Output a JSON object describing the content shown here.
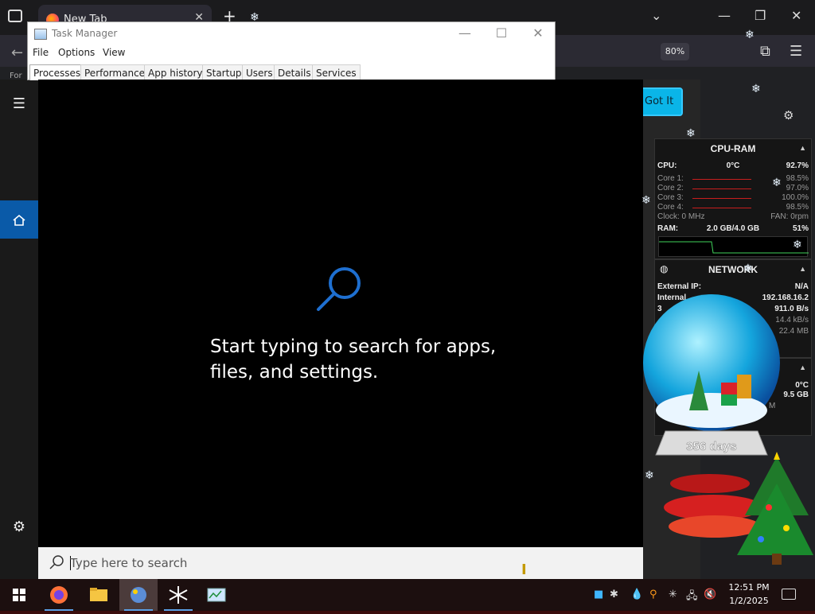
{
  "browser": {
    "tab_title": "New Tab",
    "zoom": "80%",
    "got_it_label": "Got It",
    "for_text": "For"
  },
  "task_manager": {
    "title": "Task Manager",
    "menu": [
      "File",
      "Options",
      "View"
    ],
    "tabs": [
      "Processes",
      "Performance",
      "App history",
      "Startup",
      "Users",
      "Details",
      "Services"
    ],
    "active_tab": "Processes"
  },
  "search": {
    "message_line1": "Start typing to search for apps,",
    "message_line2": "files, and settings.",
    "placeholder": "Type here to search"
  },
  "cpu_ram": {
    "title": "CPU-RAM",
    "cpu_label": "CPU:",
    "cpu_temp": "0°C",
    "cpu_value": "92.7%",
    "cores": [
      {
        "label": "Core 1:",
        "value": "98.5%"
      },
      {
        "label": "Core 2:",
        "value": "97.0%"
      },
      {
        "label": "Core 3:",
        "value": "100.0%"
      },
      {
        "label": "Core 4:",
        "value": "98.5%"
      }
    ],
    "clock": "Clock: 0 MHz",
    "fan": "FAN: 0rpm",
    "ram_label": "RAM:",
    "ram_usage": "2.0 GB/4.0 GB",
    "ram_percent": "51%"
  },
  "network": {
    "title": "NETWORK",
    "external_ip_label": "External IP:",
    "external_ip": "N/A",
    "internal_label": "Internal",
    "internal_ip": "192.168.16.2",
    "row3_label": "3",
    "row3_value": "911.0 B/s",
    "row4_value": "14.4 kB/s",
    "row5_value": "22.4 MB"
  },
  "third_widget": {
    "temp": "0°C",
    "gb": "9.5 GB",
    "m": "M"
  },
  "globe": {
    "days_label": "356 days"
  },
  "taskbar": {
    "time": "12:51 PM",
    "date": "1/2/2025"
  },
  "colors": {
    "start_accent": "#0a5aa8",
    "search_bg": "#000000",
    "taskbar_bg": "#1c0f0f"
  }
}
